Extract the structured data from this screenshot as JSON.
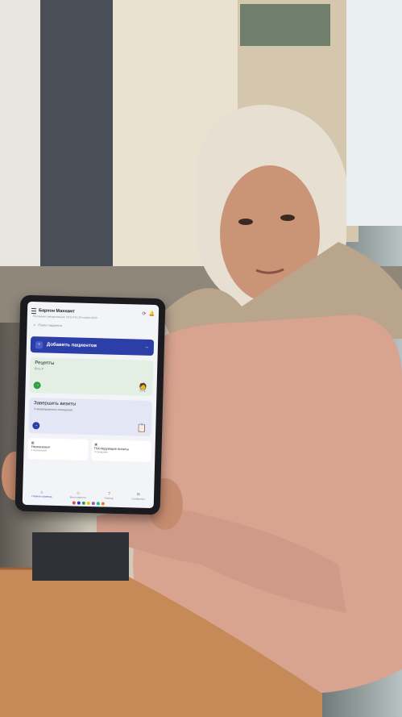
{
  "app": {
    "title": "Бархон Махкамт",
    "sync_text": "Последняя синхронизация: 20:14 PM, 03 ноября 2023"
  },
  "search": {
    "placeholder": "Поиск пациента"
  },
  "add_patient_button": {
    "label": "Добавить пациентов"
  },
  "cards": [
    {
      "title": "Рецепты",
      "subtitle": "Есть 3",
      "accent": "#2ea043"
    },
    {
      "title": "Завершить визиты",
      "subtitle": "3 незавершенных посещения",
      "accent": "#2c3ea8"
    }
  ],
  "tiles": [
    {
      "title": "Назначения",
      "subtitle": "5 Назначений"
    },
    {
      "title": "Последующие визиты",
      "subtitle": "0 Ожидания"
    }
  ],
  "bottom_nav": [
    {
      "label": "Главная страница",
      "active": true
    },
    {
      "label": "Мои пациенты",
      "active": false
    },
    {
      "label": "Помощь",
      "active": false
    },
    {
      "label": "Сообщения",
      "active": false
    }
  ],
  "colors": {
    "primary": "#2c3ea8",
    "success": "#2ea043"
  }
}
